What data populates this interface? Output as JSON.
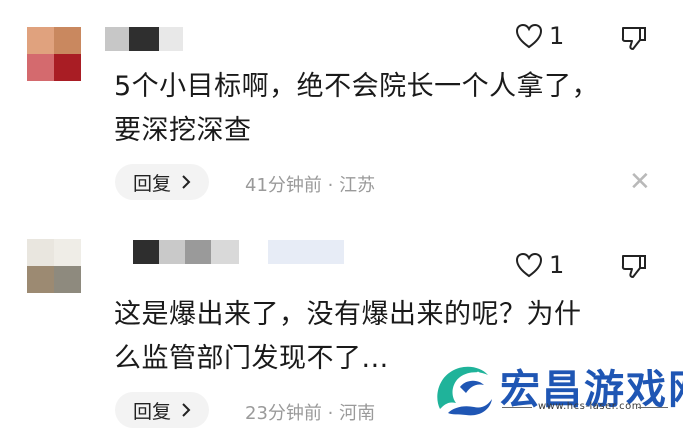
{
  "comments": [
    {
      "likes": "1",
      "text_line1": "5个小目标啊，绝不会院长一个人拿了，",
      "text_line2": "要深挖深查",
      "reply_label": "回复",
      "meta": "41分钟前 · 江苏"
    },
    {
      "likes": "1",
      "text_line1": "这是爆出来了，没有爆出来的呢？为什",
      "text_line2": "么监管部门发现不了...",
      "reply_label": "回复",
      "meta": "23分钟前 · 河南"
    }
  ],
  "icons": {
    "like": "heart-icon",
    "dislike": "thumbs-down-icon",
    "close": "close-icon",
    "reply_arrow": "chevron-right-icon"
  },
  "watermark": {
    "title": "宏昌游戏网",
    "url": "www.hcs-laser.com"
  },
  "colors": {
    "meta_text": "#9a9a9a",
    "reply_bg": "#f3f3f3",
    "watermark_blue": "#1f56b4"
  }
}
